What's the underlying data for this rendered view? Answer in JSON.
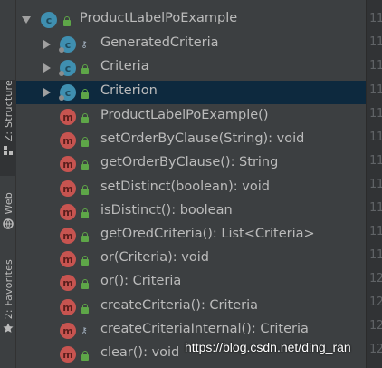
{
  "side_tabs": {
    "structure": "Z: Structure",
    "web": "Web",
    "favorites": "2: Favorites"
  },
  "tree": {
    "root": {
      "label": "ProductLabelPoExample",
      "icon": "class-icon"
    },
    "inner_classes": [
      {
        "label": "GeneratedCriteria",
        "icon": "class-icon"
      },
      {
        "label": "Criteria",
        "icon": "class-icon"
      },
      {
        "label": "Criterion",
        "icon": "class-icon"
      }
    ],
    "methods": [
      {
        "label": "ProductLabelPoExample()"
      },
      {
        "label": "setOrderByClause(String): void"
      },
      {
        "label": "getOrderByClause(): String"
      },
      {
        "label": "setDistinct(boolean): void"
      },
      {
        "label": "isDistinct(): boolean"
      },
      {
        "label": "getOredCriteria(): List<Criteria>"
      },
      {
        "label": "or(Criteria): void"
      },
      {
        "label": "or(): Criteria"
      },
      {
        "label": "createCriteria(): Criteria"
      },
      {
        "label": "createCriteriaInternal(): Criteria"
      },
      {
        "label": "clear(): void"
      }
    ]
  },
  "gutter_numbers": [
    "11",
    "11",
    "11",
    "11",
    "11",
    "11",
    "11",
    "11",
    "11",
    "11",
    "11",
    "12",
    "12",
    "12",
    "12",
    "12"
  ],
  "watermark": "https://blog.csdn.net/ding_ran",
  "colors": {
    "background": "#3c3f41",
    "selection": "#0d293e",
    "class_icon": "#3f8fb0",
    "method_icon": "#c75450",
    "public_lock": "#5ea648"
  }
}
